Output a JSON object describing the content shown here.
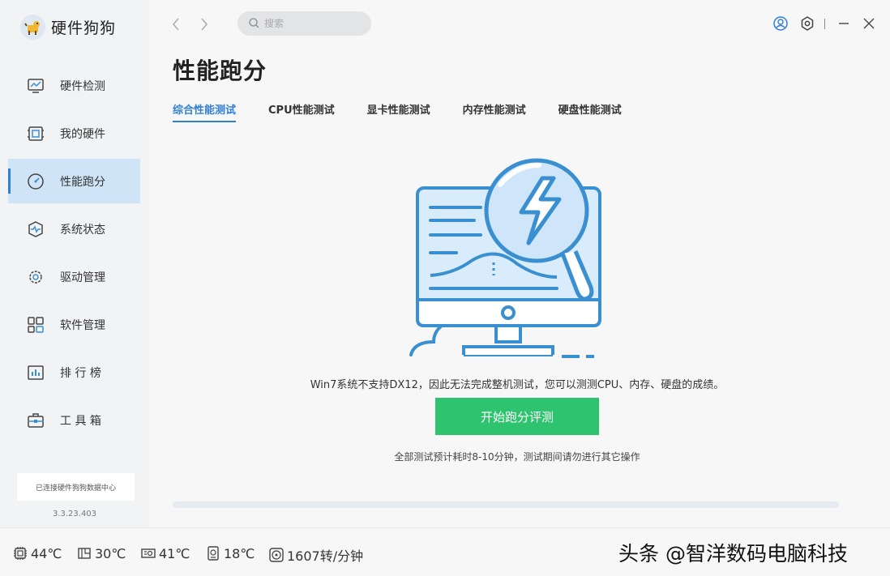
{
  "app": {
    "name": "硬件狗狗",
    "version": "3.3.23.403",
    "connection_status": "已连接硬件狗狗数据中心"
  },
  "sidebar": {
    "items": [
      {
        "label": "硬件检测",
        "icon": "monitor-chart-icon",
        "active": false
      },
      {
        "label": "我的硬件",
        "icon": "hardware-board-icon",
        "active": false
      },
      {
        "label": "性能跑分",
        "icon": "speedometer-icon",
        "active": true
      },
      {
        "label": "系统状态",
        "icon": "heartbeat-icon",
        "active": false
      },
      {
        "label": "驱动管理",
        "icon": "gear-icon",
        "active": false
      },
      {
        "label": "软件管理",
        "icon": "apps-grid-icon",
        "active": false
      },
      {
        "label": "排 行 榜",
        "icon": "bar-chart-icon",
        "active": false
      },
      {
        "label": "工 具 箱",
        "icon": "toolbox-icon",
        "active": false
      }
    ]
  },
  "topbar": {
    "search_placeholder": "搜索",
    "icons": [
      "back-arrow-icon",
      "forward-arrow-icon",
      "search-icon",
      "user-icon",
      "settings-icon",
      "minimize-icon",
      "close-icon"
    ]
  },
  "main": {
    "title": "性能跑分",
    "tabs": [
      {
        "label": "综合性能测试",
        "active": true
      },
      {
        "label": "CPU性能测试",
        "active": false
      },
      {
        "label": "显卡性能测试",
        "active": false
      },
      {
        "label": "内存性能测试",
        "active": false
      },
      {
        "label": "硬盘性能测试",
        "active": false
      }
    ],
    "notice": "Win7系统不支持DX12，因此无法完成整机测试，您可以测测CPU、内存、硬盘的成绩。",
    "start_button": "开始跑分评测",
    "hint": "全部测试预计耗时8-10分钟，测试期间请勿进行其它操作",
    "progress": 0
  },
  "footer": {
    "sensors": [
      {
        "icon": "cpu-chip-icon",
        "value": "44℃"
      },
      {
        "icon": "motherboard-icon",
        "value": "30℃"
      },
      {
        "icon": "gpu-card-icon",
        "value": "41℃"
      },
      {
        "icon": "hard-disk-icon",
        "value": "18℃"
      },
      {
        "icon": "fan-icon",
        "value": "1607转/分钟"
      }
    ],
    "watermark": "头条 @智洋数码电脑科技"
  },
  "colors": {
    "accent": "#2f7fd3",
    "start_button": "#2ec36e",
    "active_nav_bg": "#cfe4f7",
    "illustration_blue": "#3a8fd0"
  }
}
